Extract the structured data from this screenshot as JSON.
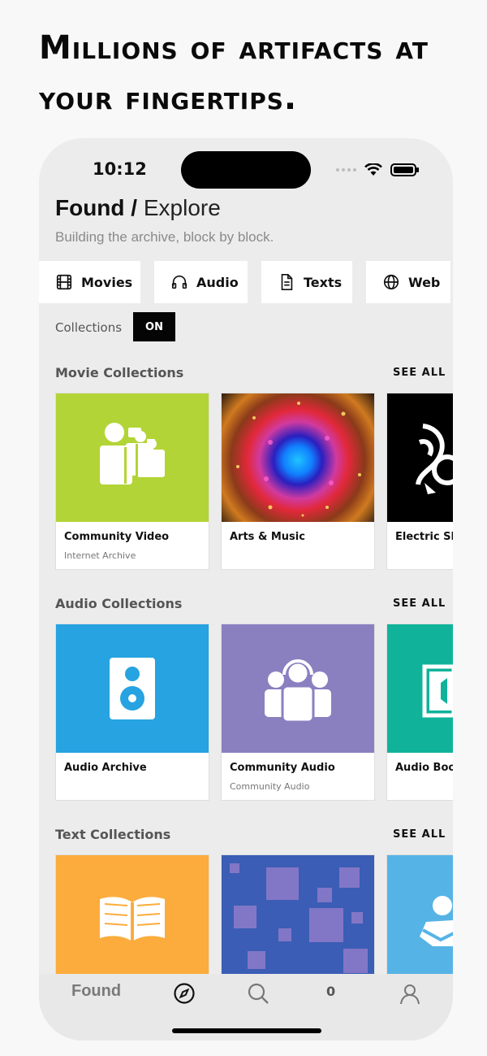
{
  "headline": {
    "line1": "Millions of artifacts at",
    "line2": "your fingertips."
  },
  "status": {
    "time": "10:12"
  },
  "header": {
    "title_bold": "Found /",
    "title_light": "Explore",
    "subtitle": "Building the archive, block by block."
  },
  "tabs": [
    {
      "label": "Movies",
      "icon": "film-icon"
    },
    {
      "label": "Audio",
      "icon": "headphones-icon"
    },
    {
      "label": "Texts",
      "icon": "document-icon"
    },
    {
      "label": "Web",
      "icon": "globe-icon"
    }
  ],
  "collections_toggle": {
    "label": "Collections",
    "state": "ON"
  },
  "sections": [
    {
      "title": "Movie Collections",
      "see_all": "SEE ALL",
      "cards": [
        {
          "title": "Community Video",
          "subtitle": "Internet Archive",
          "bg": "#b3d436"
        },
        {
          "title": "Arts & Music",
          "subtitle": "",
          "bg": "#2a1a10"
        },
        {
          "title": "Electric She",
          "subtitle": "",
          "bg": "#000000"
        }
      ]
    },
    {
      "title": "Audio Collections",
      "see_all": "SEE ALL",
      "cards": [
        {
          "title": "Audio Archive",
          "subtitle": "",
          "bg": "#26a3e0"
        },
        {
          "title": "Community Audio",
          "subtitle": "Community Audio",
          "bg": "#8a80c0"
        },
        {
          "title": "Audio Book",
          "subtitle": "",
          "bg": "#10b39a"
        }
      ]
    },
    {
      "title": "Text Collections",
      "see_all": "SEE ALL",
      "cards": [
        {
          "title": "",
          "subtitle": "",
          "bg": "#fbac3c"
        },
        {
          "title": "",
          "subtitle": "",
          "bg": "#3b5db5"
        },
        {
          "title": "",
          "subtitle": "",
          "bg": "#56b3e6"
        }
      ]
    }
  ],
  "tabbar": {
    "found_label": "Found",
    "count": "0"
  }
}
